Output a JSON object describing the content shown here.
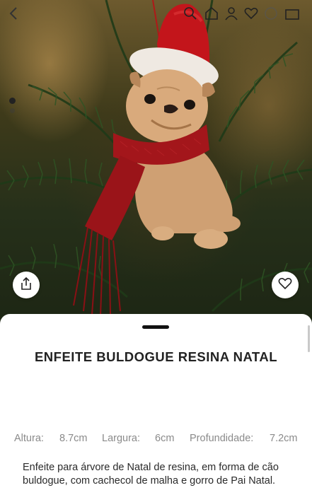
{
  "header": {
    "icons": [
      "back-icon",
      "search-icon",
      "home-icon",
      "user-icon",
      "heart-icon",
      "help-icon",
      "bag-icon"
    ]
  },
  "gallery": {
    "total_images": 2,
    "active_index": 1,
    "image_subject": "Bulldog resin ornament with red Santa hat and knitted scarf on a Christmas tree"
  },
  "actions": {
    "share_icon": "share-icon",
    "favorite_icon": "heart-icon"
  },
  "product": {
    "title": "ENFEITE BULDOGUE RESINA NATAL",
    "dimensions": {
      "height_label": "Altura:",
      "height_value": "8.7cm",
      "width_label": "Largura:",
      "width_value": "6cm",
      "depth_label": "Profundidade:",
      "depth_value": "7.2cm"
    },
    "description": "Enfeite para árvore de Natal de resina, em forma de cão buldogue, com cachecol de malha e gorro de Pai Natal."
  },
  "colors": {
    "accent": "#111111",
    "muted_text": "#8a8a8a",
    "body_text": "#2a2a2a"
  }
}
